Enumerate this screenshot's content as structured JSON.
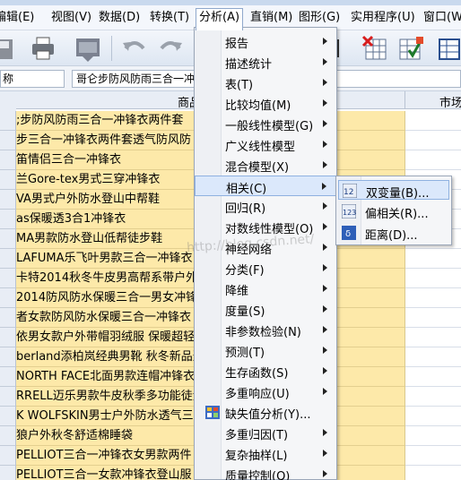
{
  "menubar": {
    "items": [
      {
        "label": "编辑(E)"
      },
      {
        "label": "视图(V)"
      },
      {
        "label": "数据(D)"
      },
      {
        "label": "转换(T)"
      },
      {
        "label": "分析(A)"
      },
      {
        "label": "直销(M)"
      },
      {
        "label": "图形(G)"
      },
      {
        "label": "实用程序(U)"
      },
      {
        "label": "窗口(W)"
      }
    ]
  },
  "editbar": {
    "name_box": "称",
    "cell_value": "哥仑步防风防雨三合一冲"
  },
  "grid": {
    "columns": [
      "商品",
      "市场"
    ],
    "rows": [
      ";步防风防雨三合一冲锋衣两件套",
      "步三合一冲锋衣两件套透气防风防",
      "笛情侣三合一冲锋衣",
      "兰Gore-tex男式三穿冲锋衣",
      "VA男式户外防水登山中帮鞋",
      "as保暖透3合1冲锋衣",
      "MA男款防水登山低帮徒步鞋",
      "LAFUMA乐飞叶男款三合一冲锋衣",
      "卡特2014秋冬牛皮男高帮系带户外",
      "2014防风防水保暖三合一男女冲锋",
      "者女款防风防水保暖三合一冲锋衣",
      "依男女款户外带帽羽绒服 保暖超轻",
      "berland添柏岚经典男靴 秋冬新品透",
      " NORTH FACE北面男款连帽冲锋衣",
      "RRELL迈乐男款牛皮秋季多功能徒步",
      "K WOLFSKIN男士户外防水透气三",
      "狼户外秋冬舒适棉睡袋",
      "PELLIOT三合一冲锋衣女男款两件",
      "PELLIOT三合一女款冲锋衣登山服"
    ]
  },
  "analyze_menu": {
    "items": [
      {
        "label": "报告",
        "has_sub": true
      },
      {
        "label": "描述统计",
        "has_sub": true
      },
      {
        "label": "表(T)",
        "has_sub": true
      },
      {
        "label": "比较均值(M)",
        "has_sub": true
      },
      {
        "label": "一般线性模型(G)",
        "has_sub": true
      },
      {
        "label": "广义线性模型",
        "has_sub": true
      },
      {
        "label": "混合模型(X)",
        "has_sub": true
      },
      {
        "label": "相关(C)",
        "has_sub": true
      },
      {
        "label": "回归(R)",
        "has_sub": true
      },
      {
        "label": "对数线性模型(O)",
        "has_sub": true
      },
      {
        "label": "神经网络",
        "has_sub": true
      },
      {
        "label": "分类(F)",
        "has_sub": true
      },
      {
        "label": "降维",
        "has_sub": true
      },
      {
        "label": "度量(S)",
        "has_sub": true
      },
      {
        "label": "非参数检验(N)",
        "has_sub": true
      },
      {
        "label": "预测(T)",
        "has_sub": true
      },
      {
        "label": "生存函数(S)",
        "has_sub": true
      },
      {
        "label": "多重响应(U)",
        "has_sub": true
      },
      {
        "label": "缺失值分析(Y)...",
        "has_sub": false
      },
      {
        "label": "多重归因(T)",
        "has_sub": true
      },
      {
        "label": "复杂抽样(L)",
        "has_sub": true
      },
      {
        "label": "质量控制(Q)",
        "has_sub": true
      }
    ]
  },
  "correlate_menu": {
    "items": [
      {
        "label": "双变量(B)...",
        "icon": "bivariate-icon"
      },
      {
        "label": "偏相关(R)...",
        "icon": "partial-correlation-icon"
      },
      {
        "label": "距离(D)...",
        "icon": "distances-icon"
      }
    ]
  },
  "watermark": "http://blog.csdn.net/",
  "colors": {
    "highlight": "#dbe8fb",
    "cell_fill": "#fde9a9",
    "menu_bg": "#f5f6f8"
  }
}
